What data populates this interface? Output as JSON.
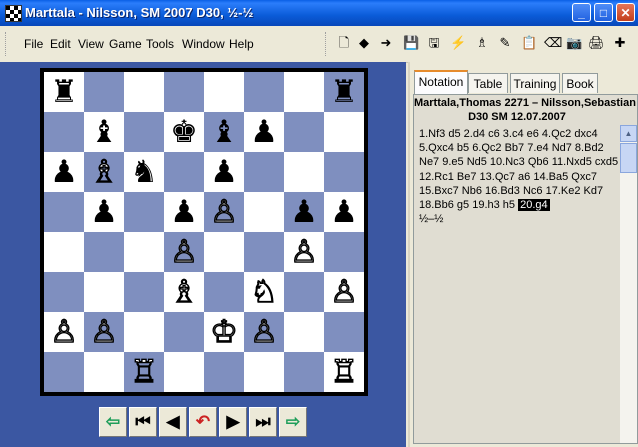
{
  "window": {
    "title": "Marttala - Nilsson, SM 2007  D30, ½-½",
    "min": "_",
    "max": "□",
    "close": "✕"
  },
  "menu": [
    "File",
    "Edit",
    "View",
    "Game",
    "Tools",
    "Window",
    "Help"
  ],
  "toolbar": [
    {
      "name": "new-doc-icon",
      "glyph": "🗋"
    },
    {
      "name": "back-arrow-icon",
      "glyph": "◆"
    },
    {
      "name": "forward-arrow-icon",
      "glyph": "➜"
    },
    {
      "name": "save-icon",
      "glyph": "💾"
    },
    {
      "name": "save-as-icon",
      "glyph": "🖫"
    },
    {
      "name": "engine-icon",
      "glyph": "⚡"
    },
    {
      "name": "analysis-icon",
      "glyph": "♗"
    },
    {
      "name": "annotation-icon",
      "glyph": "✎"
    },
    {
      "name": "copy-icon",
      "glyph": "📋"
    },
    {
      "name": "eraser-icon",
      "glyph": "⌫"
    },
    {
      "name": "camera-icon",
      "glyph": "📷"
    },
    {
      "name": "print-icon",
      "glyph": "🖨"
    },
    {
      "name": "flip-board-icon",
      "glyph": "✚"
    }
  ],
  "board": [
    [
      "bR",
      "",
      "",
      "",
      "",
      "",
      "",
      "bR"
    ],
    [
      "",
      "bB",
      "",
      "bK",
      "bB",
      "bP",
      "",
      ""
    ],
    [
      "bP",
      "wB",
      "bN",
      "",
      "bP",
      "",
      "",
      ""
    ],
    [
      "",
      "bP",
      "",
      "bP",
      "wP",
      "",
      "bP",
      "bP"
    ],
    [
      "",
      "",
      "",
      "wP",
      "",
      "",
      "wP",
      ""
    ],
    [
      "",
      "",
      "",
      "wB",
      "",
      "wN",
      "",
      "wP"
    ],
    [
      "wP",
      "wP",
      "",
      "",
      "wK",
      "wP",
      "",
      ""
    ],
    [
      "",
      "",
      "wR",
      "",
      "",
      "",
      "",
      "wR"
    ]
  ],
  "pieces": {
    "wK": "♔",
    "wQ": "♕",
    "wR": "♖",
    "wB": "♗",
    "wN": "♘",
    "wP": "♙",
    "bK": "♚",
    "bQ": "♛",
    "bR": "♜",
    "bB": "♝",
    "bN": "♞",
    "bP": "♟"
  },
  "tabs": [
    "Notation",
    "Table",
    "Training",
    "Book"
  ],
  "active_tab": "Notation",
  "game_header": {
    "players": "Marttala,Thomas 2271 – Nilsson,Sebastian",
    "info": "D30 SM 12.07.2007"
  },
  "moves_text": "1.Nf3 d5 2.d4 c6 3.c4 e6 4.Qc2 dxc4 5.Qxc4 b5 6.Qc2 Bb7 7.e4 Nd7 8.Bd2 Ne7 9.e5 Nd5 10.Nc3 Qb6 11.Nxd5 cxd5 12.Rc1 Be7 13.Qc7 a6 14.Ba5 Qxc7 15.Bxc7 Nb6 16.Bd3 Nc6 17.Ke2 Kd7 18.Bb6 g5 19.h3 h5",
  "current_move": "20.g4",
  "result": "½–½",
  "nav_buttons": [
    {
      "name": "prev-variation-button",
      "glyph": "⇦"
    },
    {
      "name": "first-move-button",
      "glyph": "⏮"
    },
    {
      "name": "prev-move-button",
      "glyph": "◀"
    },
    {
      "name": "take-back-button",
      "glyph": "↶"
    },
    {
      "name": "next-move-button",
      "glyph": "▶"
    },
    {
      "name": "last-move-button",
      "glyph": "⏭"
    },
    {
      "name": "next-variation-button",
      "glyph": "⇨"
    }
  ]
}
